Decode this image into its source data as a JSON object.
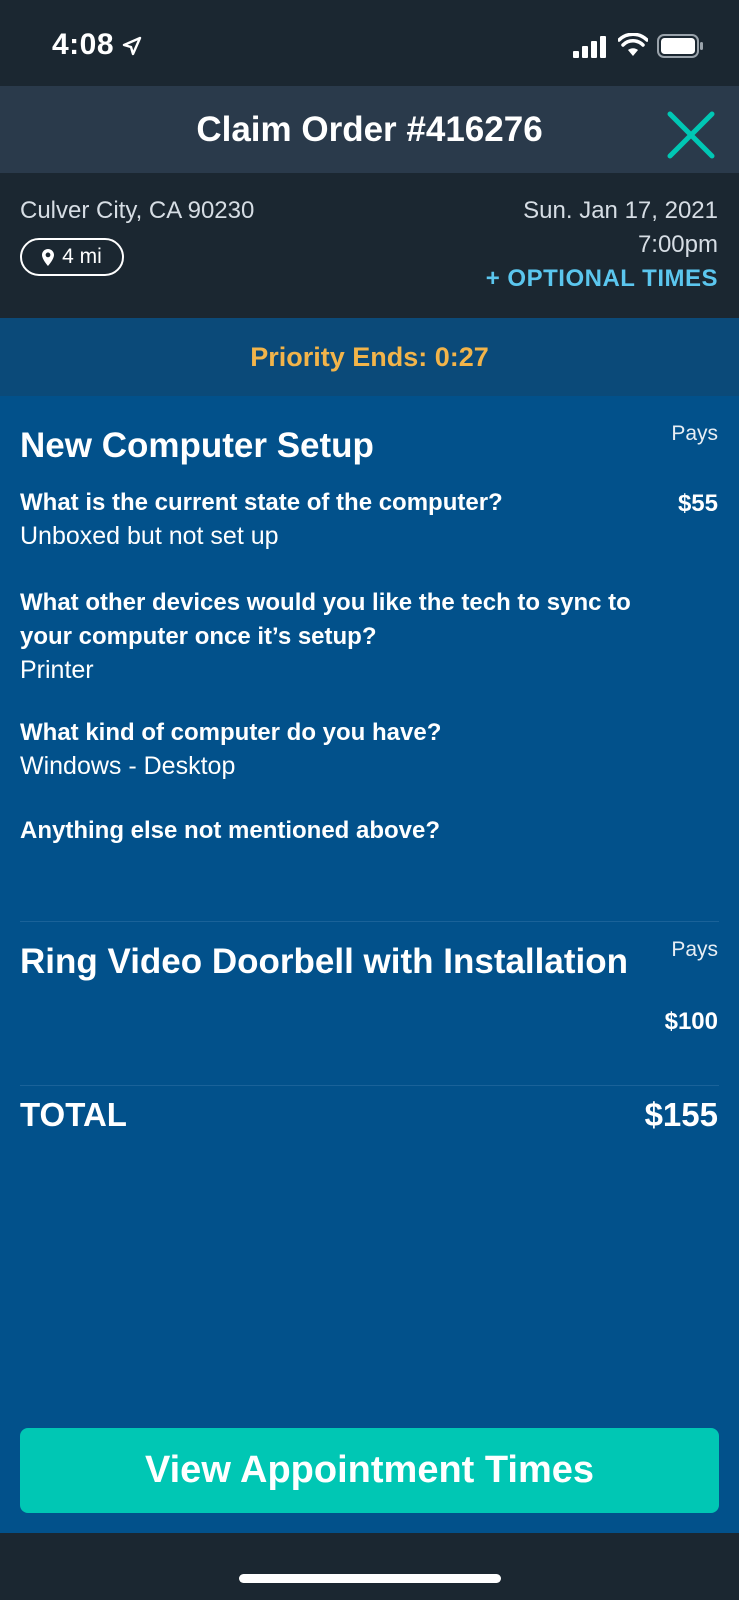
{
  "status": {
    "time": "4:08"
  },
  "header": {
    "title": "Claim Order #416276"
  },
  "info": {
    "city": "Culver City, CA 90230",
    "distance": "4 mi",
    "date": "Sun. Jan 17, 2021",
    "time": "7:00pm",
    "optional_times": "+ OPTIONAL TIMES"
  },
  "priority": {
    "text": "Priority Ends: 0:27"
  },
  "services": [
    {
      "title": "New Computer Setup",
      "pays_label": "Pays",
      "price": "$55",
      "questions": [
        {
          "q": "What is the current state of the computer?",
          "a": "Unboxed but not set up"
        },
        {
          "q": "What other devices would you like the tech to sync to your computer once it’s setup?",
          "a": "Printer"
        },
        {
          "q": "What kind of computer do you have?",
          "a": "Windows - Desktop"
        },
        {
          "q": "Anything else not mentioned above?",
          "a": ""
        }
      ]
    },
    {
      "title": "Ring Video Doorbell with Installation",
      "pays_label": "Pays",
      "price": "$100"
    }
  ],
  "total": {
    "label": "TOTAL",
    "value": "$155"
  },
  "cta": {
    "label": "View Appointment Times"
  },
  "colors": {
    "accent_teal": "#00c7b4",
    "priority_orange": "#f2b44a",
    "link_blue": "#5bc6ee",
    "content_blue": "#02518b"
  }
}
